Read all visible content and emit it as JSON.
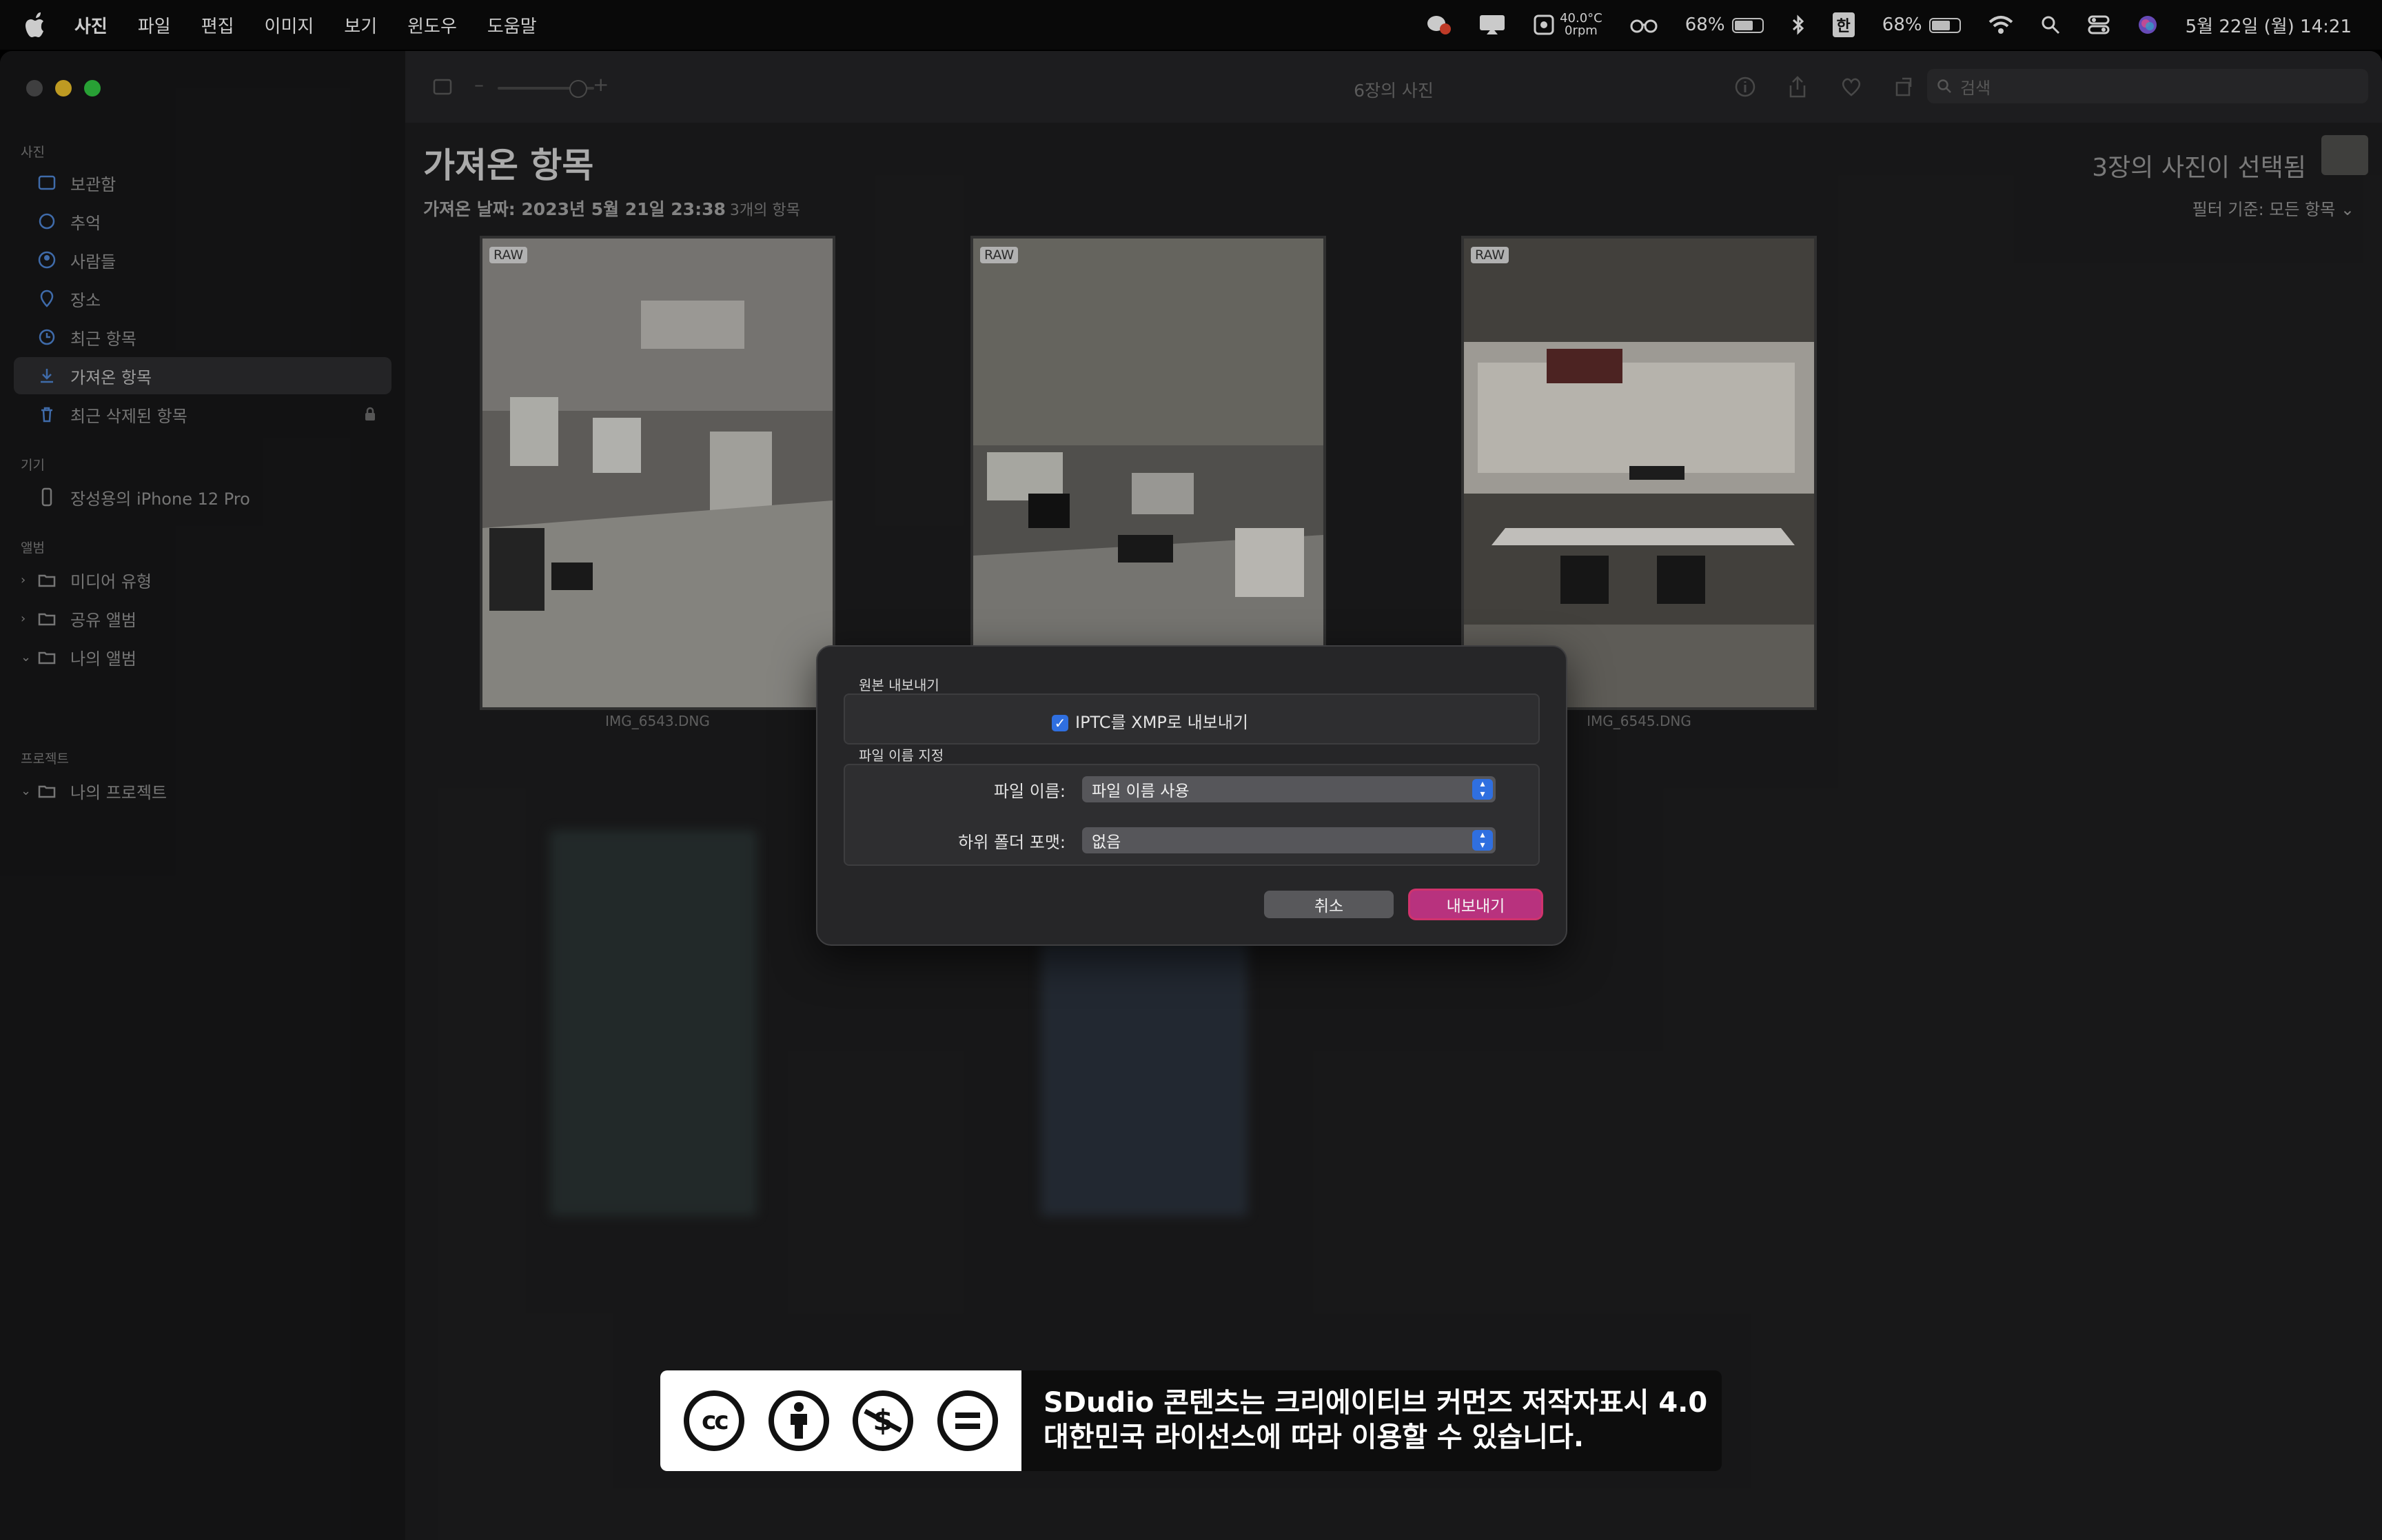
{
  "menubar": {
    "app": "사진",
    "items": [
      "파일",
      "편집",
      "이미지",
      "보기",
      "윈도우",
      "도움말"
    ],
    "temp": "40.0°C",
    "rpm": "0rpm",
    "battery_pct_1": "68%",
    "input_method": "한",
    "battery_pct_2": "68%",
    "datetime": "5월 22일 (월) 14:21"
  },
  "sidebar": {
    "section_photos": "사진",
    "items": [
      "보관함",
      "추억",
      "사람들",
      "장소",
      "최근 항목",
      "가져온 항목",
      "최근 삭제된 항목"
    ],
    "section_devices": "기기",
    "device": "장성용의 iPhone 12 Pro",
    "section_albums": "앨범",
    "albums": [
      "미디어 유형",
      "공유 앨범",
      "나의 앨범"
    ],
    "section_projects": "프로젝트",
    "projects": [
      "나의 프로젝트"
    ]
  },
  "toolbar": {
    "title": "6장의 사진",
    "zoom_minus": "–",
    "zoom_plus": "+",
    "search_placeholder": "검색"
  },
  "content": {
    "heading": "가져온 항목",
    "import_date": "가져온 날짜: 2023년 5월 21일 23:38",
    "item_count": "3개의 항목",
    "selected_text": "3장의 사진이 선택됨",
    "filter": "필터 기준: 모든 항목",
    "photos": [
      {
        "badge": "RAW",
        "name": "IMG_6543.DNG"
      },
      {
        "badge": "RAW",
        "name": ""
      },
      {
        "badge": "RAW",
        "name": "IMG_6545.DNG"
      }
    ]
  },
  "dialog": {
    "section1": "원본 내보내기",
    "checkbox_label": "IPTC를 XMP로 내보내기",
    "checkbox_checked": true,
    "section2": "파일 이름 지정",
    "filename_label": "파일 이름:",
    "filename_value": "파일 이름 사용",
    "subfolder_label": "하위 폴더 포맷:",
    "subfolder_value": "없음",
    "cancel": "취소",
    "export": "내보내기"
  },
  "license": {
    "line1": "SDudio 콘텐츠는 크리에이티브 커먼즈 저작자표시 4.0",
    "line2": "대한민국 라이선스에 따라 이용할 수 있습니다."
  },
  "colors": {
    "accent_blue": "#2f6fe0",
    "export_button": "#b8327e"
  }
}
